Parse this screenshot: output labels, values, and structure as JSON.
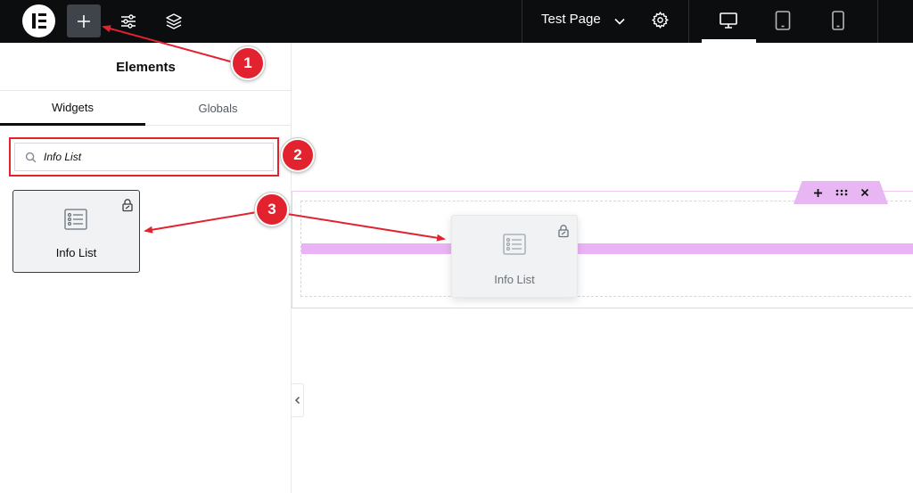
{
  "topbar": {
    "logo_icon": "elementor-logo-icon",
    "add_icon": "plus-icon",
    "settings_icon": "sliders-icon",
    "structure_icon": "layers-icon",
    "page_title": "Test Page",
    "page_settings_icon": "gear-icon",
    "devices": [
      {
        "name": "desktop",
        "icon": "desktop-icon",
        "active": true
      },
      {
        "name": "tablet",
        "icon": "tablet-icon"
      },
      {
        "name": "mobile",
        "icon": "mobile-icon"
      }
    ]
  },
  "panel": {
    "title": "Elements",
    "tabs": [
      {
        "label": "Widgets",
        "selected": true
      },
      {
        "label": "Globals"
      }
    ],
    "search": {
      "value": "Info List"
    },
    "widgets": [
      {
        "label": "Info List",
        "icon": "info-list-icon",
        "badge_icon": "pro-lock-icon"
      }
    ]
  },
  "canvas": {
    "drag_preview_label": "Info List",
    "section_controls": [
      "add",
      "drag",
      "close"
    ]
  },
  "annotations": {
    "steps": [
      "1",
      "2",
      "3"
    ],
    "color": "#e2232f"
  },
  "colors": {
    "accent_pink": "#eab3f5",
    "topbar": "#0c0d0e"
  }
}
